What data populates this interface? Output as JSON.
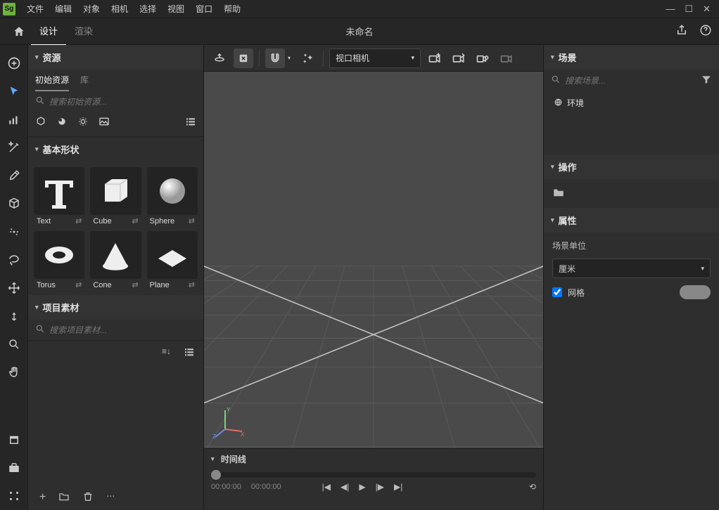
{
  "app": {
    "icon_label": "Sg",
    "title": "未命名"
  },
  "menubar": {
    "file": "文件",
    "edit": "编辑",
    "object": "对象",
    "camera": "相机",
    "select": "选择",
    "view": "视图",
    "window": "窗口",
    "help": "帮助"
  },
  "mode_tabs": {
    "design": "设计",
    "render": "渲染"
  },
  "resources": {
    "header": "资源",
    "tab_starter": "初始资源",
    "tab_library": "库",
    "search_placeholder": "搜索初始资源...",
    "shapes_header": "基本形状",
    "shapes": [
      "Text",
      "Cube",
      "Sphere",
      "Torus",
      "Cone",
      "Plane"
    ],
    "project_header": "项目素材",
    "project_search_placeholder": "搜索项目素材..."
  },
  "viewport": {
    "camera_label": "视口相机"
  },
  "timeline": {
    "header": "时间线",
    "t1": "00:00:00",
    "t2": "00:00:00"
  },
  "scene": {
    "header": "场景",
    "search_placeholder": "搜索场景...",
    "env": "环境",
    "ops_header": "操作",
    "props_header": "属性",
    "unit_label": "场景单位",
    "unit_value": "厘米",
    "grid_label": "网格"
  }
}
